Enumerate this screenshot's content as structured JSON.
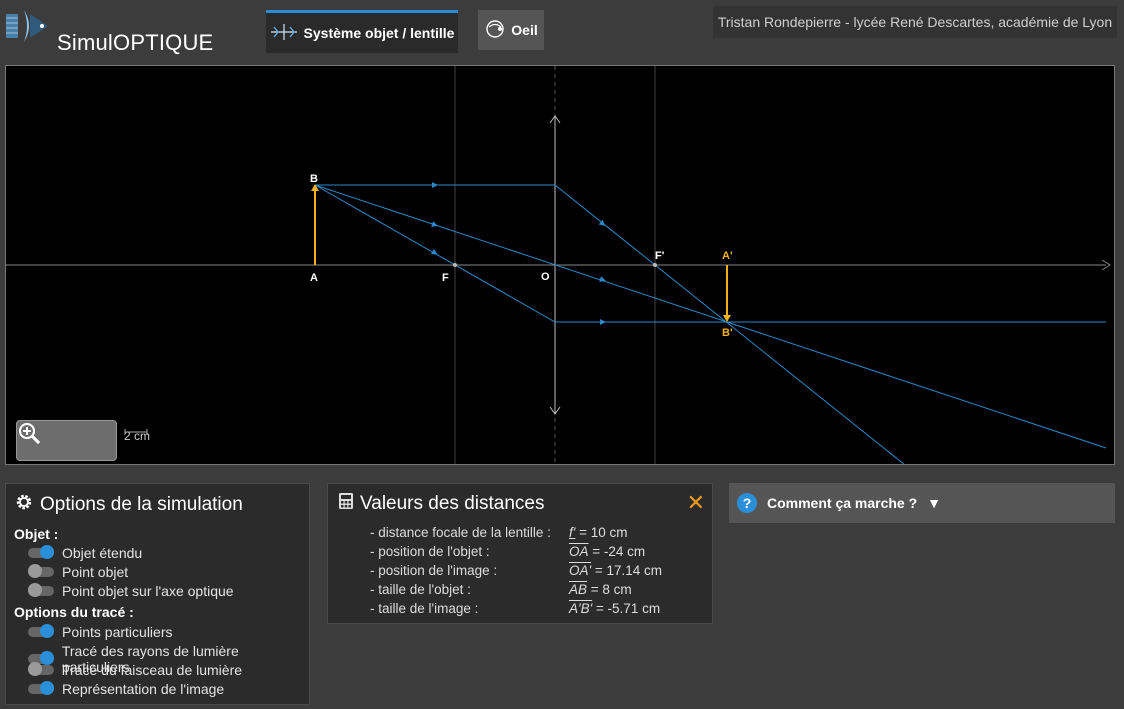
{
  "header": {
    "app_title": "SimulOPTIQUE",
    "tabs": [
      {
        "label": "Système objet / lentille",
        "icon": "lens-system-icon",
        "active": true
      },
      {
        "label": "Oeil",
        "icon": "eye-icon",
        "active": false
      }
    ],
    "author": "Tristan Rondepierre - lycée René Descartes, académie de Lyon"
  },
  "canvas": {
    "labels": {
      "B": "B",
      "A": "A",
      "F": "F",
      "O": "O",
      "Fp": "F'",
      "Ap": "A'",
      "Bp": "B'"
    },
    "scale_label": "2 cm",
    "colors": {
      "background": "#000000",
      "ray": "#2b89c9",
      "object": "#f2b11b",
      "axis": "#888888"
    }
  },
  "options": {
    "title": "Options de la simulation",
    "object_section": "Objet :",
    "object_items": [
      {
        "label": "Objet étendu",
        "on": true
      },
      {
        "label": "Point objet",
        "on": false
      },
      {
        "label": "Point objet sur l'axe optique",
        "on": false
      }
    ],
    "trace_section": "Options du tracé :",
    "trace_items": [
      {
        "label": "Points particuliers",
        "on": true
      },
      {
        "label": "Tracé des rayons de lumière particuliers",
        "on": true
      },
      {
        "label": "Tracé du faisceau de lumière",
        "on": false
      },
      {
        "label": "Représentation de l'image",
        "on": true
      }
    ]
  },
  "values": {
    "title": "Valeurs des distances",
    "close": "✕",
    "rows": [
      {
        "label": "- distance focale de la lentille :",
        "symbol": "f'",
        "overline": false,
        "value": " = 10 cm"
      },
      {
        "label": "- position de l'objet :",
        "symbol": "OA",
        "overline": true,
        "value": " = -24 cm"
      },
      {
        "label": "- position de l'image :",
        "symbol": "OA'",
        "overline": true,
        "value": " = 17.14 cm"
      },
      {
        "label": "- taille de l'objet :",
        "symbol": "AB",
        "overline": true,
        "value": " = 8 cm"
      },
      {
        "label": "- taille de l'image :",
        "symbol": "A'B'",
        "overline": true,
        "value": " = -5.71 cm"
      }
    ]
  },
  "help": {
    "icon_text": "?",
    "label": "Comment ça marche ?",
    "arrow": "▼"
  }
}
